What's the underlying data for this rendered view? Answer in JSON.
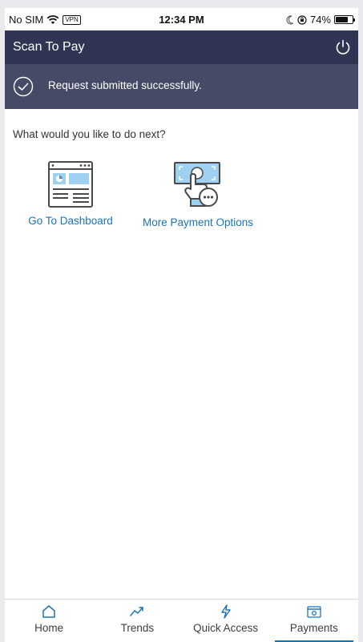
{
  "status_bar": {
    "carrier": "No SIM",
    "vpn": "VPN",
    "time": "12:34 PM",
    "battery": "74%",
    "battery_level": 0.74
  },
  "header": {
    "title": "Scan To Pay"
  },
  "banner": {
    "message": "Request submitted successfully."
  },
  "content": {
    "prompt": "What would you like to do next?",
    "options": [
      {
        "label": "Go To Dashboard",
        "icon": "dashboard-icon"
      },
      {
        "label": "More Payment Options",
        "icon": "payment-options-icon"
      }
    ]
  },
  "bottom_nav": {
    "items": [
      {
        "label": "Home",
        "icon": "home-icon"
      },
      {
        "label": "Trends",
        "icon": "trends-icon"
      },
      {
        "label": "Quick Access",
        "icon": "lightning-icon"
      },
      {
        "label": "Payments",
        "icon": "payments-icon",
        "active": true
      }
    ]
  },
  "colors": {
    "header_bg": "#2f3553",
    "banner_bg": "#454b66",
    "link": "#1a73b7",
    "icon_accent": "#9fd2f2",
    "icon_stroke": "#4a4a4a"
  }
}
